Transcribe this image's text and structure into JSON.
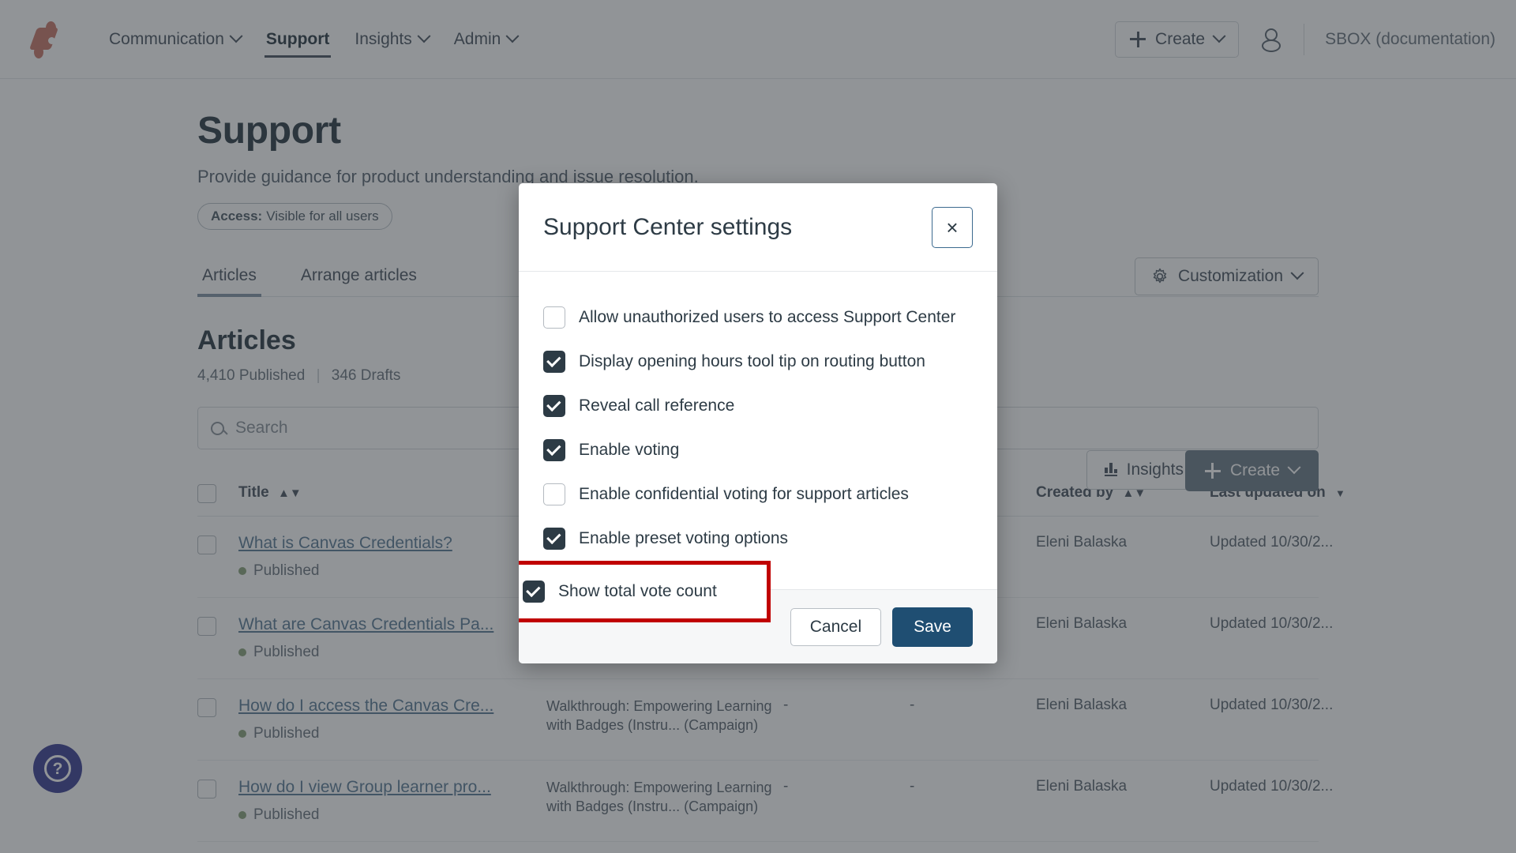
{
  "topnav": {
    "logo_name": "brand-logo",
    "items": [
      {
        "label": "Communication",
        "has_caret": true,
        "active": false
      },
      {
        "label": "Support",
        "has_caret": false,
        "active": true
      },
      {
        "label": "Insights",
        "has_caret": true,
        "active": false
      },
      {
        "label": "Admin",
        "has_caret": true,
        "active": false
      }
    ],
    "create_label": "Create",
    "org_label": "SBOX (documentation)"
  },
  "page": {
    "title": "Support",
    "subtitle": "Provide guidance for product understanding and issue resolution.",
    "access_label": "Access:",
    "access_value": "Visible for all users",
    "customization_label": "Customization",
    "tabs": [
      {
        "label": "Articles",
        "active": true
      },
      {
        "label": "Arrange articles",
        "active": false
      }
    ],
    "section_title": "Articles",
    "published_count": "4,410 Published",
    "drafts_count": "346 Drafts",
    "search_placeholder": "Search",
    "insights_label": "Insights",
    "create_label": "Create",
    "help_label": "?"
  },
  "table": {
    "columns": [
      {
        "key": "title",
        "label": "Title",
        "sort": "updown"
      },
      {
        "key": "assoc",
        "label": "",
        "sort": "none"
      },
      {
        "key": "n1",
        "label": "",
        "sort": "none"
      },
      {
        "key": "n2",
        "label": "",
        "sort": "none"
      },
      {
        "key": "by",
        "label": "Created by",
        "sort": "updown"
      },
      {
        "key": "updated",
        "label": "Last updated on",
        "sort": "down"
      }
    ],
    "rows": [
      {
        "title": "What is Canvas Credentials?",
        "status": "Published",
        "assoc": "",
        "n1": "",
        "n2": "",
        "by": "Eleni Balaska",
        "updated": "Updated 10/30/2..."
      },
      {
        "title": "What are Canvas Credentials Pa...",
        "status": "Published",
        "assoc": "",
        "n1": "",
        "n2": "",
        "by": "Eleni Balaska",
        "updated": "Updated 10/30/2..."
      },
      {
        "title": "How do I access the Canvas Cre...",
        "status": "Published",
        "assoc": "Walkthrough: Empowering Learning with Badges (Instru... (Campaign)",
        "n1": "-",
        "n2": "-",
        "by": "Eleni Balaska",
        "updated": "Updated 10/30/2..."
      },
      {
        "title": "How do I view Group learner pro...",
        "status": "Published",
        "assoc": "Walkthrough: Empowering Learning with Badges (Instru... (Campaign)",
        "n1": "-",
        "n2": "-",
        "by": "Eleni Balaska",
        "updated": "Updated 10/30/2..."
      }
    ]
  },
  "modal": {
    "title": "Support Center settings",
    "close_label": "×",
    "options": [
      {
        "label": "Allow unauthorized users to access Support Center",
        "checked": false,
        "highlighted": false
      },
      {
        "label": "Display opening hours tool tip on routing button",
        "checked": true,
        "highlighted": false
      },
      {
        "label": "Reveal call reference",
        "checked": true,
        "highlighted": false
      },
      {
        "label": "Enable voting",
        "checked": true,
        "highlighted": false
      },
      {
        "label": "Enable confidential voting for support articles",
        "checked": false,
        "highlighted": false
      },
      {
        "label": "Enable preset voting options",
        "checked": true,
        "highlighted": false
      },
      {
        "label": "Show total vote count",
        "checked": true,
        "highlighted": true
      }
    ],
    "cancel_label": "Cancel",
    "save_label": "Save"
  },
  "colors": {
    "brand_logo": "#c8776a",
    "accent_blue": "#1f4e72",
    "highlight_red": "#c00000",
    "link_blue": "#5b7b96",
    "status_green": "#8aa37b",
    "help_fab": "#3b3f95"
  }
}
